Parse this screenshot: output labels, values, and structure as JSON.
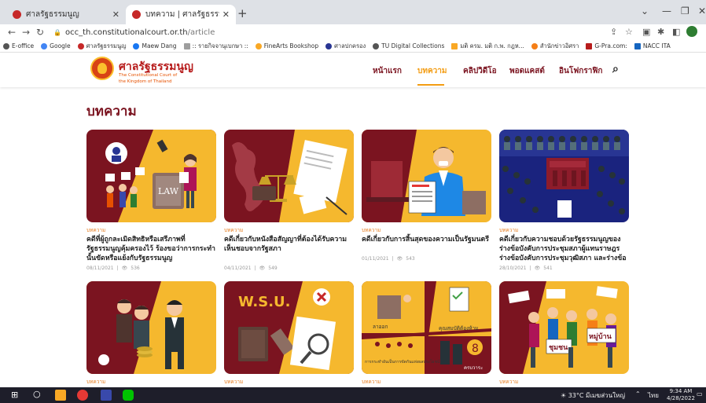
{
  "browser": {
    "tabs": [
      {
        "label": "ศาลรัฐธรรมนูญ",
        "active": false
      },
      {
        "label": "บทความ | ศาลรัฐธรรมนูญ",
        "active": true
      }
    ],
    "url_host": "occ_th.constitutionalcourt.or.th",
    "url_path": "/article",
    "bookmarks": [
      "E-office",
      "Google",
      "ศาลรัฐธรรมนูญ",
      "Maew Dang",
      ":: รายกิจจานุเบกษา ::",
      "FineArts Bookshop",
      "ศาลปกครอง",
      "TU Digital Collections",
      "มติ ครม. มติ ก.พ. กฎห...",
      "สำนักข่าวอิศรา",
      "G-Pra.com:",
      "NACC ITA"
    ]
  },
  "site": {
    "brand_th": "ศาลรัฐธรรมนูญ",
    "brand_en_1": "The Constitutional Court of",
    "brand_en_2": "the Kingdom of Thailand",
    "nav": [
      "หน้าแรก",
      "บทความ",
      "คลิปวิดีโอ",
      "พอดแคสต์",
      "อินโฟกราฟิก"
    ],
    "active_nav": "บทความ"
  },
  "page": {
    "title": "บทความ",
    "cards": [
      {
        "category": "บทความ",
        "title": "คดีที่ผู้ถูกละเมิดสิทธิหรือเสรีภาพที่รัฐธรรมนูญคุ้มครองไว้ ร้องขอว่าการกระทำนั้นขัดหรือแย้งกับรัฐธรรมนูญ",
        "date": "08/11/2021",
        "views": "536"
      },
      {
        "category": "บทความ",
        "title": "คดีเกี่ยวกับหนังสือสัญญาที่ต้องได้รับความเห็นชอบจากรัฐสภา",
        "date": "04/11/2021",
        "views": "549"
      },
      {
        "category": "บทความ",
        "title": "คดีเกี่ยวกับการสิ้นสุดของความเป็นรัฐมนตรี",
        "date": "01/11/2021",
        "views": "543"
      },
      {
        "category": "บทความ",
        "title": "คดีเกี่ยวกับความชอบด้วยรัฐธรรมนูญของร่างข้อบังคับการประชุมสภาผู้แทนราษฎร ร่างข้อบังคับการประชุมวุฒิสภา และร่างข้อ",
        "date": "28/10/2021",
        "views": "541"
      },
      {
        "category": "บทความ",
        "title": "",
        "date": "",
        "views": ""
      },
      {
        "category": "บทความ",
        "title": "",
        "date": "",
        "views": ""
      },
      {
        "category": "บทความ",
        "title": "",
        "date": "",
        "views": ""
      },
      {
        "category": "บทความ",
        "title": "",
        "date": "",
        "views": ""
      }
    ],
    "thumb_texts": {
      "law": "LAW",
      "wsu": "W.S.U.",
      "ch3_a": "ลาออก",
      "ch3_b": "คุณสมบัติต้องห้าม",
      "ch3_c": "การกระทำอันเป็นการขัดกันแห่งผลประโยชน์",
      "ch3_d": "ครบวาระ",
      "ch4_a": "ชุมชน",
      "ch4_b": "หมู่บ้าน"
    }
  },
  "taskbar": {
    "weather": "33°C มีเมฆส่วนใหญ่",
    "lang": "ไทย",
    "time": "9:34 AM",
    "date": "4/28/2022"
  },
  "colors": {
    "maroon": "#7b1420",
    "yellow": "#f5b82e",
    "accent": "#f39c12"
  }
}
